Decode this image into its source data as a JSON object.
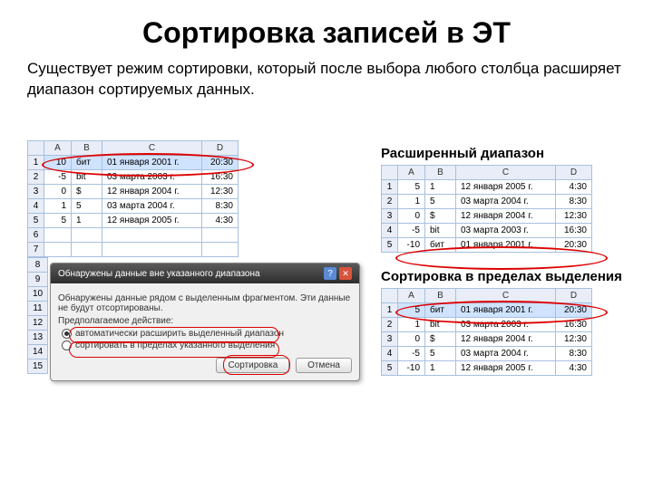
{
  "title": "Сортировка записей в ЭТ",
  "intro": "Существует режим сортировки, который после выбора любого столбца расширяет диапазон сортируемых данных.",
  "labels": {
    "expanded": "Расширенный диапазон",
    "within_sel": "Сортировка в пределах выделения"
  },
  "cols": [
    "A",
    "B",
    "C",
    "D"
  ],
  "table_left": [
    {
      "a": "10",
      "b": "бит",
      "c": "01 января 2001 г.",
      "d": "20:30"
    },
    {
      "a": "-5",
      "b": "bit",
      "c": "03 марта 2003 г.",
      "d": "16:30"
    },
    {
      "a": "0",
      "b": "$",
      "c": "12 января 2004 г.",
      "d": "12:30"
    },
    {
      "a": "1",
      "b": "5",
      "c": "03 марта 2004 г.",
      "d": "8:30"
    },
    {
      "a": "5",
      "b": "1",
      "c": "12 января 2005 г.",
      "d": "4:30"
    }
  ],
  "table_top_right": [
    {
      "a": "5",
      "b": "1",
      "c": "12 января 2005 г.",
      "d": "4:30"
    },
    {
      "a": "1",
      "b": "5",
      "c": "03 марта 2004 г.",
      "d": "8:30"
    },
    {
      "a": "0",
      "b": "$",
      "c": "12 января 2004 г.",
      "d": "12:30"
    },
    {
      "a": "-5",
      "b": "bit",
      "c": "03 марта 2003 г.",
      "d": "16:30"
    },
    {
      "a": "-10",
      "b": "бит",
      "c": "01 января 2001 г.",
      "d": "20:30"
    }
  ],
  "table_bottom_right": [
    {
      "a": "5",
      "b": "бит",
      "c": "01 января 2001 г.",
      "d": "20:30"
    },
    {
      "a": "1",
      "b": "bit",
      "c": "03 марта 2003 г.",
      "d": "16:30"
    },
    {
      "a": "0",
      "b": "$",
      "c": "12 января 2004 г.",
      "d": "12:30"
    },
    {
      "a": "-5",
      "b": "5",
      "c": "03 марта 2004 г.",
      "d": "8:30"
    },
    {
      "a": "-10",
      "b": "1",
      "c": "12 января 2005 г.",
      "d": "4:30"
    }
  ],
  "dialog": {
    "title": "Обнаружены данные вне указанного диапазона",
    "help": "?",
    "body1": "Обнаружены данные рядом с выделенным фрагментом. Эти данные не будут отсортированы.",
    "body2": "Предполагаемое действие:",
    "opt1": "автоматически расширить выделенный диапазон",
    "opt2": "сортировать в пределах указанного выделения",
    "sort_btn": "Сортировка",
    "cancel_btn": "Отмена"
  }
}
